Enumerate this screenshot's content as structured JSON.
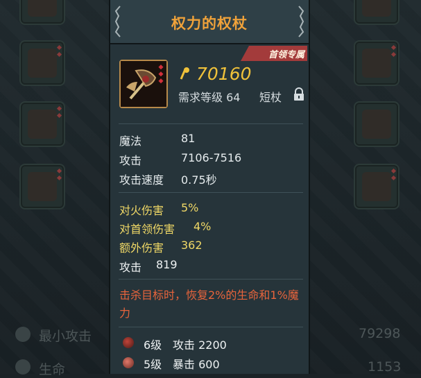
{
  "background": {
    "stats": [
      {
        "label": "最小攻击",
        "value": "79298",
        "icon": "sword-icon"
      },
      {
        "label": "生命",
        "value": "1153",
        "icon": "heart-icon"
      }
    ]
  },
  "tooltip": {
    "title": "权力的权杖",
    "tag": "首领专属",
    "gold_value": "70160",
    "requirement": "需求等级 64",
    "weapon_type": "短杖",
    "base_stats": [
      {
        "label": "魔法",
        "value": "81"
      },
      {
        "label": "攻击",
        "value": "7106-7516"
      },
      {
        "label": "攻击速度",
        "value": "0.75秒"
      }
    ],
    "bonus_stats": [
      {
        "label": "对火伤害",
        "value": "5%"
      },
      {
        "label": "对首领伤害",
        "value": "4%"
      },
      {
        "label": "额外伤害",
        "value": "362"
      }
    ],
    "extra_stat": {
      "label": "攻击",
      "value": "819"
    },
    "effect": "击杀目标时，恢复2%的生命和1%魔力",
    "gems": [
      {
        "level": "6级",
        "stat": "攻击 2200"
      },
      {
        "level": "5级",
        "stat": "暴击 600"
      }
    ]
  },
  "colors": {
    "title": "#f0a23a",
    "gold": "#f0c23a",
    "bonus": "#f0d866",
    "effect": "#e8643c",
    "tag": "#a33b3b"
  }
}
